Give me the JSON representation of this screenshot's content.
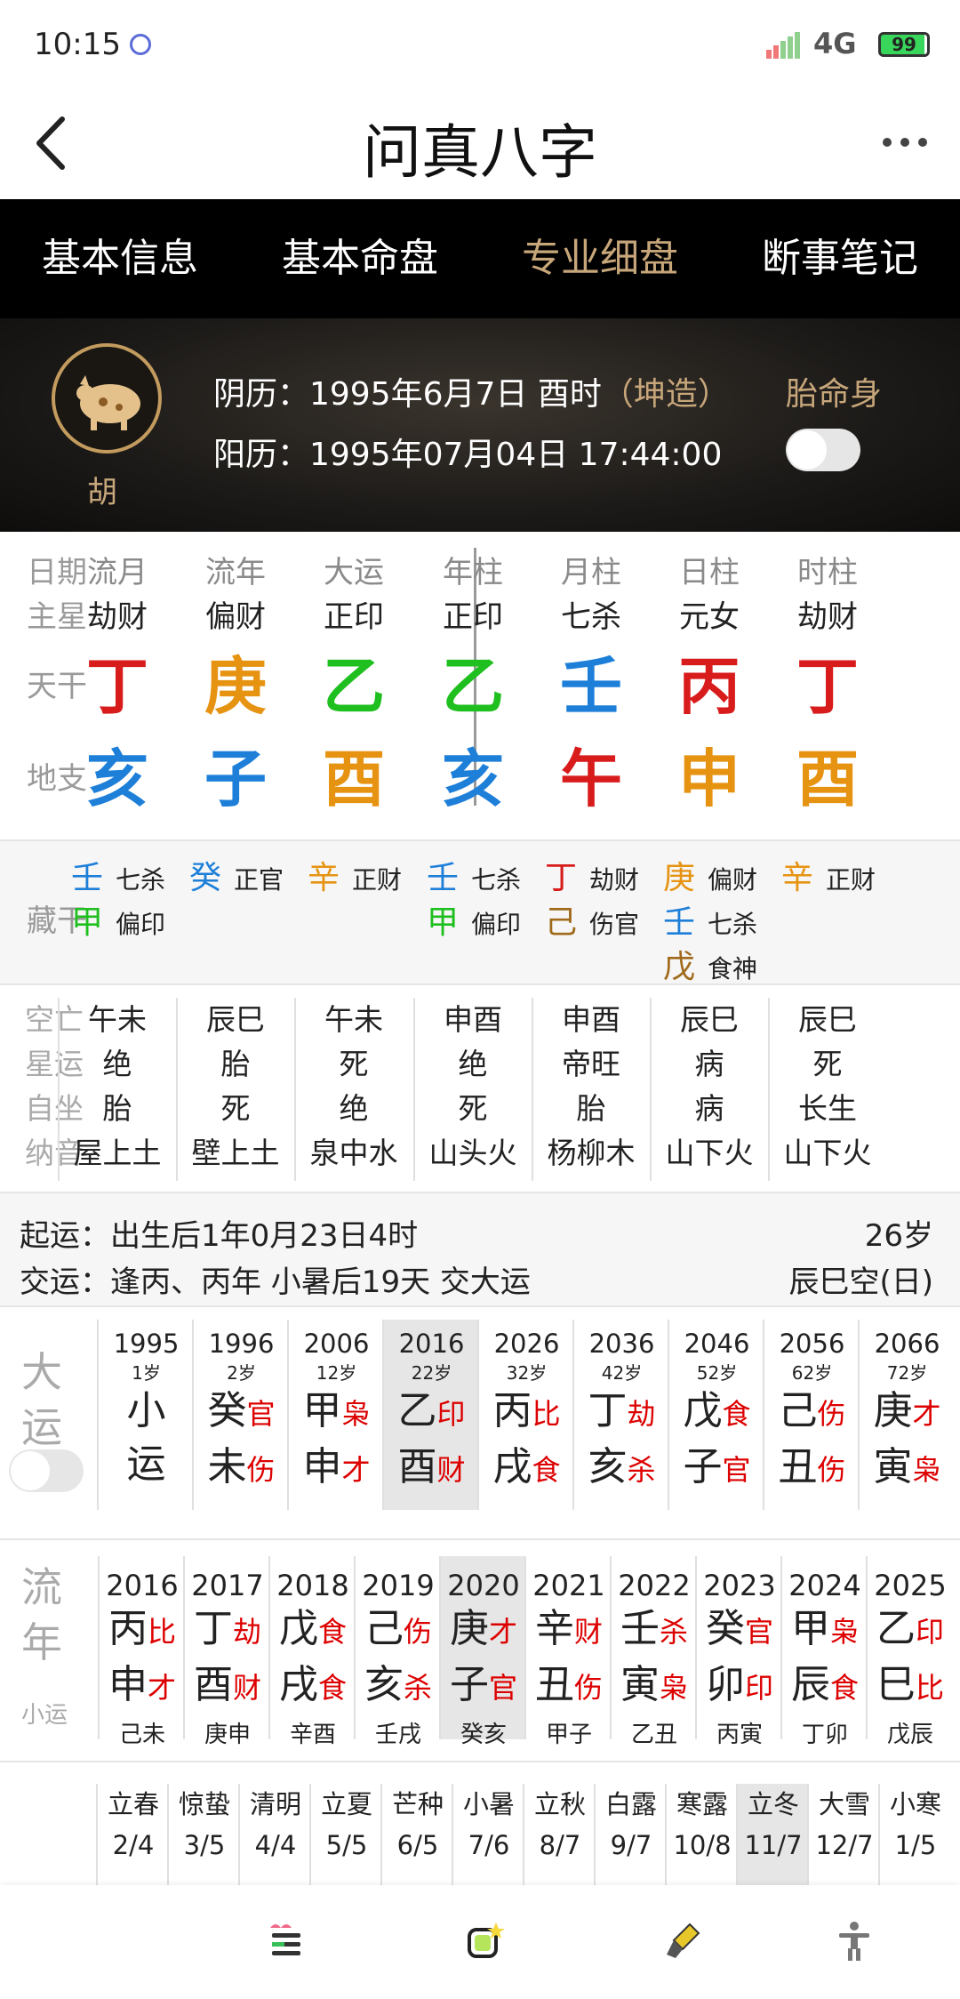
{
  "status": {
    "time": "10:15",
    "network": "4G",
    "battery": "99"
  },
  "header": {
    "title": "问真八字"
  },
  "tabs": [
    "基本信息",
    "基本命盘",
    "专业细盘",
    "断事笔记"
  ],
  "profile": {
    "surname": "胡",
    "lunar_label": "阴历：1995年6月7日 酉时",
    "gender": "（坤造）",
    "solar_label": "阳历：1995年07月04日 17:44:00",
    "toggle_label": "胎命身"
  },
  "pillars": {
    "row_labels": {
      "date": "日期",
      "star": "主星",
      "stem": "天干",
      "branch": "地支"
    },
    "columns": [
      {
        "head": "流月",
        "star": "劫财",
        "stem": "丁",
        "stem_color": "#d81b1b",
        "branch": "亥",
        "branch_color": "#1e7fd9"
      },
      {
        "head": "流年",
        "star": "偏财",
        "stem": "庚",
        "stem_color": "#e69312",
        "branch": "子",
        "branch_color": "#1e7fd9"
      },
      {
        "head": "大运",
        "star": "正印",
        "stem": "乙",
        "stem_color": "#1fbf1f",
        "branch": "酉",
        "branch_color": "#e69312"
      },
      {
        "head": "年柱",
        "star": "正印",
        "stem": "乙",
        "stem_color": "#1fbf1f",
        "branch": "亥",
        "branch_color": "#1e7fd9"
      },
      {
        "head": "月柱",
        "star": "七杀",
        "stem": "壬",
        "stem_color": "#1e7fd9",
        "branch": "午",
        "branch_color": "#d81b1b"
      },
      {
        "head": "日柱",
        "star": "元女",
        "stem": "丙",
        "stem_color": "#d81b1b",
        "branch": "申",
        "branch_color": "#e69312"
      },
      {
        "head": "时柱",
        "star": "劫财",
        "stem": "丁",
        "stem_color": "#d81b1b",
        "branch": "酉",
        "branch_color": "#e69312"
      }
    ]
  },
  "hidden_stems": {
    "label": "藏干",
    "columns": [
      [
        {
          "g": "壬",
          "c": "#1e7fd9",
          "s": "七杀"
        },
        {
          "g": "甲",
          "c": "#1fbf1f",
          "s": "偏印"
        }
      ],
      [
        {
          "g": "癸",
          "c": "#1e7fd9",
          "s": "正官"
        }
      ],
      [
        {
          "g": "辛",
          "c": "#e69312",
          "s": "正财"
        }
      ],
      [
        {
          "g": "壬",
          "c": "#1e7fd9",
          "s": "七杀"
        },
        {
          "g": "甲",
          "c": "#1fbf1f",
          "s": "偏印"
        }
      ],
      [
        {
          "g": "丁",
          "c": "#d81b1b",
          "s": "劫财"
        },
        {
          "g": "己",
          "c": "#a06a1a",
          "s": "伤官"
        }
      ],
      [
        {
          "g": "庚",
          "c": "#e69312",
          "s": "偏财"
        },
        {
          "g": "壬",
          "c": "#1e7fd9",
          "s": "七杀"
        },
        {
          "g": "戊",
          "c": "#a06a1a",
          "s": "食神"
        }
      ],
      [
        {
          "g": "辛",
          "c": "#e69312",
          "s": "正财"
        }
      ]
    ]
  },
  "details": {
    "labels": [
      "空亡",
      "星运",
      "自坐",
      "纳音"
    ],
    "columns": [
      [
        "午未",
        "绝",
        "胎",
        "屋上土"
      ],
      [
        "辰巳",
        "胎",
        "死",
        "壁上土"
      ],
      [
        "午未",
        "死",
        "绝",
        "泉中水"
      ],
      [
        "申酉",
        "绝",
        "死",
        "山头火"
      ],
      [
        "申酉",
        "帝旺",
        "胎",
        "杨柳木"
      ],
      [
        "辰巳",
        "病",
        "病",
        "山下火"
      ],
      [
        "辰巳",
        "死",
        "长生",
        "山下火"
      ]
    ]
  },
  "luck": {
    "start": "起运：出生后1年0月23日4时",
    "handover": "交运：逢丙、丙年 小暑后19天 交大运",
    "age": "26岁",
    "void": "辰巳空(日)"
  },
  "dayun": {
    "side_label": [
      "大",
      "运"
    ],
    "items": [
      {
        "year": "1995",
        "age": "1岁",
        "g": "小",
        "gs": "",
        "z": "运",
        "zs": ""
      },
      {
        "year": "1996",
        "age": "2岁",
        "g": "癸",
        "gs": "官",
        "z": "未",
        "zs": "伤"
      },
      {
        "year": "2006",
        "age": "12岁",
        "g": "甲",
        "gs": "枭",
        "z": "申",
        "zs": "才"
      },
      {
        "year": "2016",
        "age": "22岁",
        "g": "乙",
        "gs": "印",
        "z": "酉",
        "zs": "财"
      },
      {
        "year": "2026",
        "age": "32岁",
        "g": "丙",
        "gs": "比",
        "z": "戌",
        "zs": "食"
      },
      {
        "year": "2036",
        "age": "42岁",
        "g": "丁",
        "gs": "劫",
        "z": "亥",
        "zs": "杀"
      },
      {
        "year": "2046",
        "age": "52岁",
        "g": "戊",
        "gs": "食",
        "z": "子",
        "zs": "官"
      },
      {
        "year": "2056",
        "age": "62岁",
        "g": "己",
        "gs": "伤",
        "z": "丑",
        "zs": "伤"
      },
      {
        "year": "2066",
        "age": "72岁",
        "g": "庚",
        "gs": "才",
        "z": "寅",
        "zs": "枭"
      }
    ],
    "selected_index": 3
  },
  "liunian": {
    "side_label": [
      "流",
      "年"
    ],
    "sub_label": "小运",
    "items": [
      {
        "year": "2016",
        "g": "丙",
        "gs": "比",
        "z": "申",
        "zs": "才",
        "xy": "己未"
      },
      {
        "year": "2017",
        "g": "丁",
        "gs": "劫",
        "z": "酉",
        "zs": "财",
        "xy": "庚申"
      },
      {
        "year": "2018",
        "g": "戊",
        "gs": "食",
        "z": "戌",
        "zs": "食",
        "xy": "辛酉"
      },
      {
        "year": "2019",
        "g": "己",
        "gs": "伤",
        "z": "亥",
        "zs": "杀",
        "xy": "壬戌"
      },
      {
        "year": "2020",
        "g": "庚",
        "gs": "才",
        "z": "子",
        "zs": "官",
        "xy": "癸亥"
      },
      {
        "year": "2021",
        "g": "辛",
        "gs": "财",
        "z": "丑",
        "zs": "伤",
        "xy": "甲子"
      },
      {
        "year": "2022",
        "g": "壬",
        "gs": "杀",
        "z": "寅",
        "zs": "枭",
        "xy": "乙丑"
      },
      {
        "year": "2023",
        "g": "癸",
        "gs": "官",
        "z": "卯",
        "zs": "印",
        "xy": "丙寅"
      },
      {
        "year": "2024",
        "g": "甲",
        "gs": "枭",
        "z": "辰",
        "zs": "食",
        "xy": "丁卯"
      },
      {
        "year": "2025",
        "g": "乙",
        "gs": "印",
        "z": "巳",
        "zs": "比",
        "xy": "戊辰"
      }
    ],
    "selected_index": 4
  },
  "solar_terms": {
    "items": [
      {
        "name": "立春",
        "date": "2/4"
      },
      {
        "name": "惊蛰",
        "date": "3/5"
      },
      {
        "name": "清明",
        "date": "4/4"
      },
      {
        "name": "立夏",
        "date": "5/5"
      },
      {
        "name": "芒种",
        "date": "6/5"
      },
      {
        "name": "小暑",
        "date": "7/6"
      },
      {
        "name": "立秋",
        "date": "8/7"
      },
      {
        "name": "白露",
        "date": "9/7"
      },
      {
        "name": "寒露",
        "date": "10/8"
      },
      {
        "name": "立冬",
        "date": "11/7"
      },
      {
        "name": "大雪",
        "date": "12/7"
      },
      {
        "name": "小寒",
        "date": "1/5"
      }
    ],
    "selected_index": 9
  },
  "bottom_nav": [
    "list-icon",
    "sticker-icon",
    "brush-icon",
    "accessibility-icon"
  ]
}
